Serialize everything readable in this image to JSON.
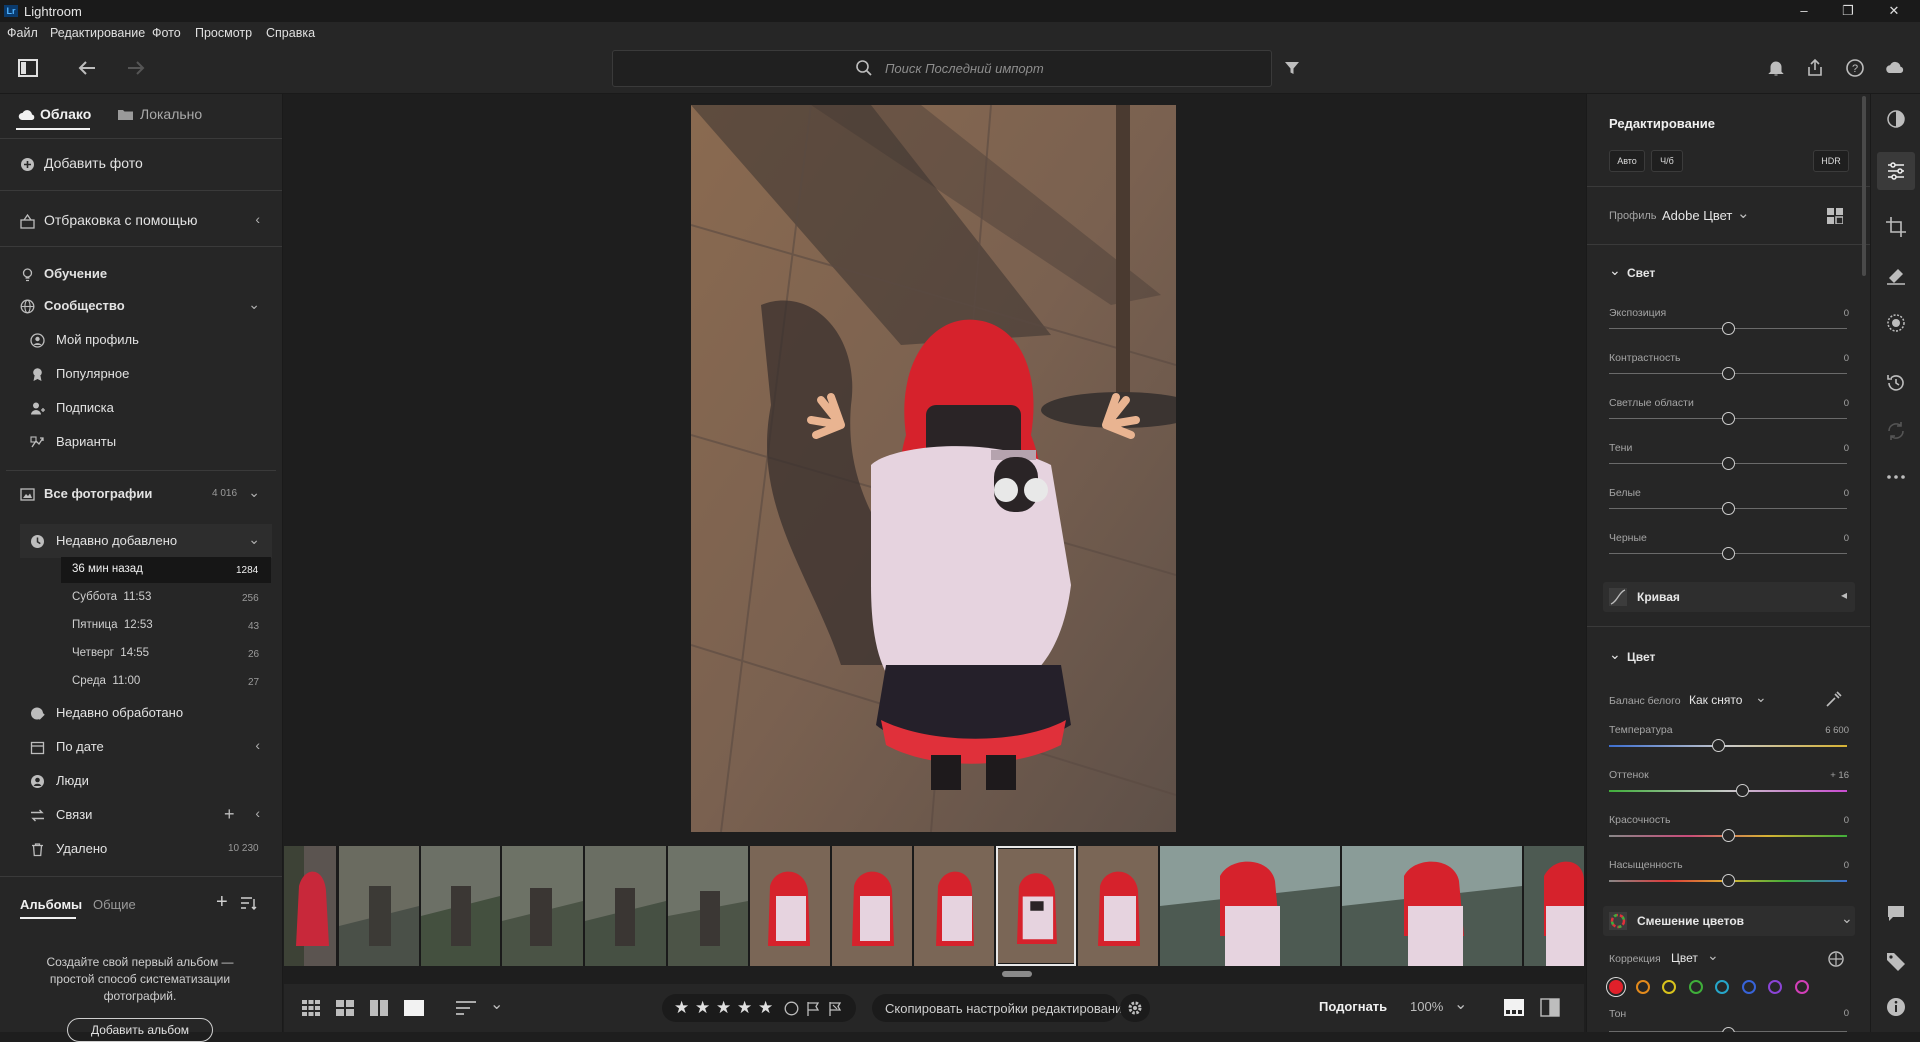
{
  "window": {
    "app_title": "Lightroom",
    "logo_text": "Lr"
  },
  "menu": [
    "Файл",
    "Редактирование",
    "Фото",
    "Просмотр",
    "Справка"
  ],
  "search": {
    "placeholder": "Поиск Последний импорт"
  },
  "left": {
    "tabs": {
      "cloud": "Облако",
      "local": "Локально"
    },
    "add_photo": "Добавить фото",
    "assisted_culling": "Отбраковка с помощью",
    "learn": "Обучение",
    "community": "Сообщество",
    "community_items": [
      "Мой профиль",
      "Популярное",
      "Подписка",
      "Варианты"
    ],
    "all_photos": {
      "label": "Все фотографии",
      "count": "4 016"
    },
    "recently_added": "Недавно добавлено",
    "recent_items": [
      {
        "label": "36 мин назад",
        "count": "1284"
      },
      {
        "label": "Суббота  11:53",
        "count": "256"
      },
      {
        "label": "Пятница  12:53",
        "count": "43"
      },
      {
        "label": "Четверг  14:55",
        "count": "26"
      },
      {
        "label": "Среда  11:00",
        "count": "27"
      }
    ],
    "recently_edited": "Недавно обработано",
    "by_date": "По дате",
    "people": "Люди",
    "connections": "Связи",
    "deleted": {
      "label": "Удалено",
      "count": "10 230"
    },
    "albums_tabs": {
      "albums": "Альбомы",
      "shared": "Общие"
    },
    "albums_empty": "Создайте свой первый альбом — простой способ систематизации фотографий.",
    "create_album": "Добавить альбом"
  },
  "bottom": {
    "copy_settings": "Скопировать настройки редактирования",
    "fit": "Подогнать",
    "zoom": "100%",
    "stars": [
      "★",
      "★",
      "★",
      "★",
      "★"
    ]
  },
  "edit": {
    "title": "Редактирование",
    "buttons": {
      "auto": "Авто",
      "bw": "Ч/б",
      "hdr": "HDR"
    },
    "profile_label": "Профиль",
    "profile_value": "Adobe Цвет",
    "light": {
      "title": "Свет",
      "sliders": [
        {
          "label": "Экспозиция",
          "value": "0",
          "pos": 0.5
        },
        {
          "label": "Контрастность",
          "value": "0",
          "pos": 0.5
        },
        {
          "label": "Светлые области",
          "value": "0",
          "pos": 0.5
        },
        {
          "label": "Тени",
          "value": "0",
          "pos": 0.5
        },
        {
          "label": "Белые",
          "value": "0",
          "pos": 0.5
        },
        {
          "label": "Черные",
          "value": "0",
          "pos": 0.5
        }
      ]
    },
    "curve": "Кривая",
    "color": {
      "title": "Цвет",
      "wb_label": "Баланс белого",
      "wb_value": "Как снято",
      "sliders": [
        {
          "label": "Температура",
          "value": "6 600",
          "pos": 0.46
        },
        {
          "label": "Оттенок",
          "value": "+ 16",
          "pos": 0.56
        },
        {
          "label": "Красочность",
          "value": "0",
          "pos": 0.5
        },
        {
          "label": "Насыщенность",
          "value": "0",
          "pos": 0.5
        }
      ]
    },
    "color_mix": {
      "title": "Смешение цветов",
      "correction_label": "Коррекция",
      "correction_value": "Цвет",
      "swatches": [
        "#e0202a",
        "#e38a1c",
        "#d8c21c",
        "#3fae3a",
        "#26a6c9",
        "#3763d8",
        "#8b44d6",
        "#d13fb7"
      ],
      "tone_label": "Тон",
      "tone_value": "0"
    }
  }
}
